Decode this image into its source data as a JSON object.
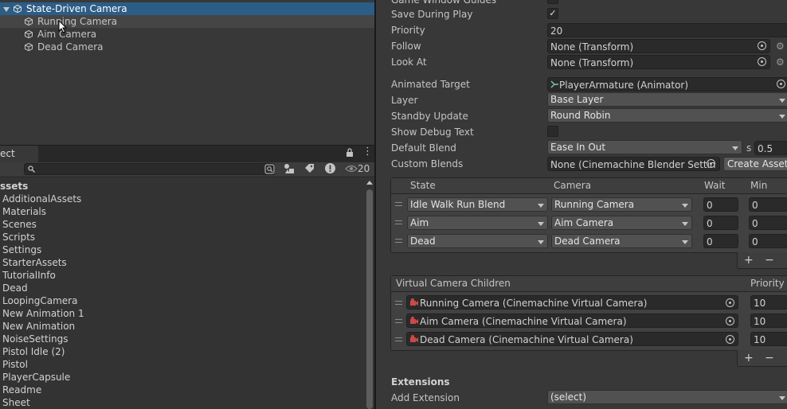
{
  "hierarchy": {
    "items": [
      {
        "label": "State-Driven Camera"
      },
      {
        "label": "Running Camera"
      },
      {
        "label": "Aim Camera"
      },
      {
        "label": "Dead Camera"
      }
    ]
  },
  "project": {
    "tab_label": "ect",
    "hidden_count": "20",
    "root_label": "ssets",
    "assets": [
      "AdditionalAssets",
      "Materials",
      "Scenes",
      "Scripts",
      "Settings",
      "StarterAssets",
      "TutorialInfo",
      "Dead",
      "LoopingCamera",
      "New Animation 1",
      "New Animation",
      "NoiseSettings",
      "Pistol Idle (2)",
      "Pistol",
      "PlayerCapsule",
      "Readme",
      "Sheet"
    ]
  },
  "inspector": {
    "top_cut_label": "Game Window Guides",
    "save_during_play": {
      "label": "Save During Play",
      "checked": true
    },
    "priority": {
      "label": "Priority",
      "value": "20"
    },
    "follow": {
      "label": "Follow",
      "value": "None (Transform)"
    },
    "look_at": {
      "label": "Look At",
      "value": "None (Transform)"
    },
    "animated_target": {
      "label": "Animated Target",
      "value": "PlayerArmature (Animator)"
    },
    "layer": {
      "label": "Layer",
      "value": "Base Layer"
    },
    "standby_update": {
      "label": "Standby Update",
      "value": "Round Robin"
    },
    "show_debug_text": {
      "label": "Show Debug Text",
      "checked": false
    },
    "default_blend": {
      "label": "Default Blend",
      "value": "Ease In Out",
      "unit": "s",
      "time": "0.5"
    },
    "custom_blends": {
      "label": "Custom Blends",
      "value": "None (Cinemachine Blender Settin",
      "button": "Create Asset"
    },
    "state_table": {
      "headers": {
        "state": "State",
        "camera": "Camera",
        "wait": "Wait",
        "min": "Min"
      },
      "rows": [
        {
          "state": "Idle Walk Run Blend",
          "camera": "Running Camera",
          "wait": "0",
          "min": "0"
        },
        {
          "state": "Aim",
          "camera": "Aim Camera",
          "wait": "0",
          "min": "0"
        },
        {
          "state": "Dead",
          "camera": "Dead Camera",
          "wait": "0",
          "min": "0"
        }
      ],
      "add": "+",
      "remove": "−"
    },
    "children": {
      "header": "Virtual Camera Children",
      "priority_header": "Priority",
      "rows": [
        {
          "name": "Running Camera (Cinemachine Virtual Camera)",
          "priority": "10"
        },
        {
          "name": "Aim Camera (Cinemachine Virtual Camera)",
          "priority": "10"
        },
        {
          "name": "Dead Camera (Cinemachine Virtual Camera)",
          "priority": "10"
        }
      ],
      "add": "+",
      "remove": "−"
    },
    "extensions": {
      "title": "Extensions",
      "label": "Add Extension",
      "value": "(select)"
    }
  }
}
